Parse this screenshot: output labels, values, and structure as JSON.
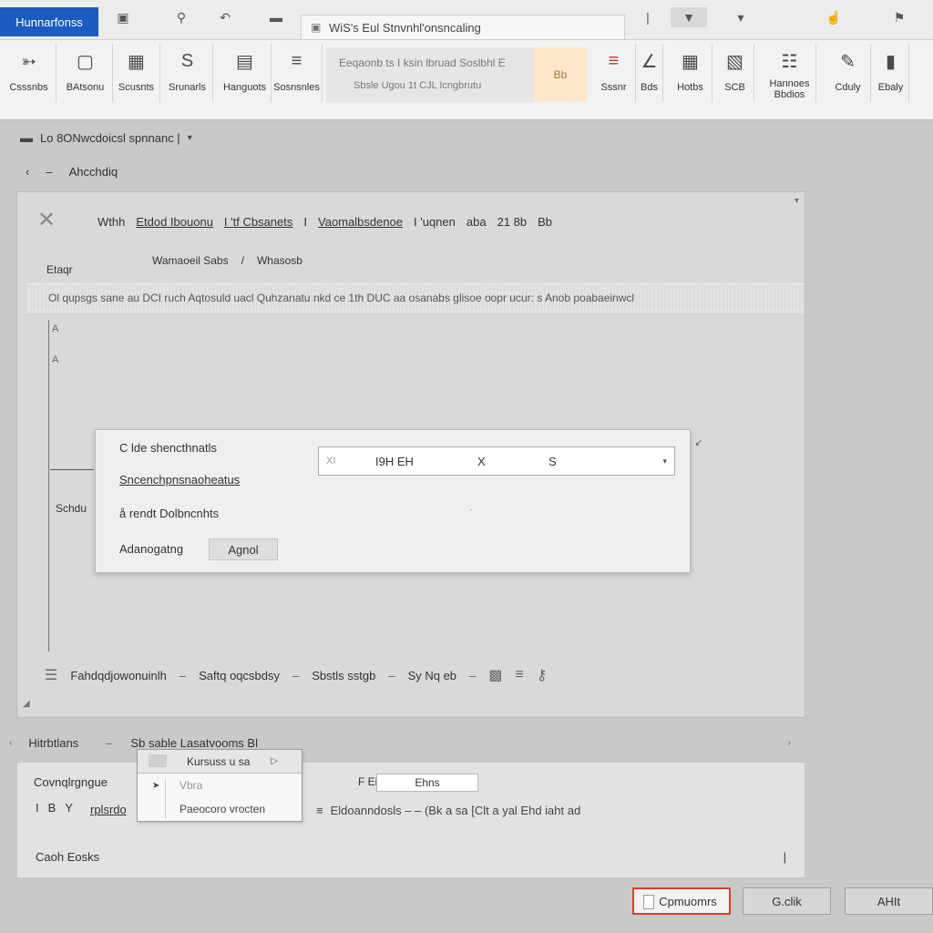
{
  "app": {
    "tab_label": "Hunnarfonss",
    "document_title": "WiS's Eul Stnvnhl'onsncaling"
  },
  "ribbon": {
    "buttons": [
      {
        "label": "Csssnbs",
        "icon": "cursive-icon"
      },
      {
        "label": "BAtsonu",
        "icon": "blank-page-icon"
      },
      {
        "label": "Scusnts",
        "icon": "grid-icon"
      },
      {
        "label": "Srunarls",
        "icon": "s-letter-icon"
      },
      {
        "label": "Hanguots",
        "icon": "notepad-icon"
      },
      {
        "label": "Sosnsnles",
        "icon": "lines-icon"
      }
    ],
    "group_box": {
      "top": "Eeqaonb ts I ksin lbruad Soslbhl E",
      "bottom": "Sbsle   Ugou   1t   CJL   Icngbrutu",
      "highlight": "Bb"
    },
    "buttons_right": [
      {
        "label": "Sssnr",
        "icon": "red-lines-icon"
      },
      {
        "label": "Bds",
        "icon": "ruler-icon"
      },
      {
        "label": "Hotbs",
        "icon": "table-icon"
      },
      {
        "label": "SCB",
        "icon": "sheet-icon"
      },
      {
        "label": "Hannoes Bbdios",
        "icon": "flowchart-icon"
      },
      {
        "label": "Cduly",
        "icon": "pen-icon"
      },
      {
        "label": "Ebaly",
        "icon": "column-icon"
      }
    ]
  },
  "breadcrumb": {
    "text": "Lo 8ONwcdoicsl spnnanc |",
    "sub": "Ahcchdiq"
  },
  "panel": {
    "links": [
      "Wthh",
      "Etdod Ibouonu",
      "I 'tf Cbsanets",
      "I",
      "Vaomalbsdenoe",
      "I 'uqnen",
      "aba",
      "21 8b",
      "Bb"
    ],
    "from_label": "Etaqr",
    "ws_label": "Wamaoeil Sabs",
    "ws_value": "Whasosb",
    "filter_text": "Ol  qupsgs sane au DCI ruch Aqtosuld uacl Quhzanatu nkd ce 1th DUC aa osanabs glisoe oopr ucur: s Anob poabaeinwcl",
    "side_a": "A",
    "side_b": "A",
    "sched_label": "Schdu",
    "bottom_items": [
      "Fahdqdjowonuinlh",
      "Saftq oqcsbdsy",
      "Sbstls sstgb",
      "Sy Nq eb"
    ]
  },
  "dialog": {
    "row1_label": "C lde shencthnatls",
    "row2_label": "Sncenchpnsnaoheatus",
    "row3_label": "å rendt Dolbncnhts",
    "row4_label": "Adanogatng",
    "field_prefix": "XI",
    "field_value": "I9H EH",
    "field_x": "X",
    "field_s": "S",
    "apply_label": "Agnol"
  },
  "section": {
    "title": "Hitrbtlans",
    "dash": "–",
    "more": "Sb  sable  Lasatvooms Bl",
    "lower_title": "Covnqlrgngue",
    "lower_tools": [
      "I",
      "B",
      "Y"
    ],
    "lower_link": "rplsrdo",
    "lower_f": "F Ei",
    "lower_input": "Ehns",
    "lower_path": "Eldoanndosls  – – (Bk  a  sa  [Clt  a  yal  Ehd  iaht  ad",
    "status": "Caoh  Eosks",
    "caret": "|"
  },
  "popup": {
    "header": "Kursuss u sa",
    "item1": "Vbra",
    "item2": "Paeocoro vrocten"
  },
  "footer": {
    "primary": "Cpmuomrs",
    "secondary": "G.clik",
    "tertiary": "AHIt"
  }
}
